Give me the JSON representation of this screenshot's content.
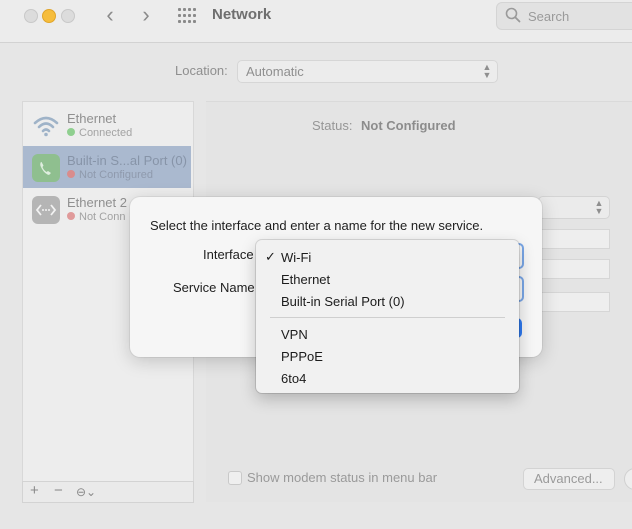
{
  "window": {
    "title": "Network"
  },
  "search": {
    "placeholder": "Search"
  },
  "location": {
    "label": "Location:",
    "value": "Automatic"
  },
  "services": [
    {
      "name": "Ethernet",
      "status": "Connected",
      "status_color": "#5cbf5c"
    },
    {
      "name": "Built-in S...al Port (0)",
      "status": "Not Configured",
      "status_color": "#e35b56"
    },
    {
      "name": "Ethernet 2",
      "status": "Not Conn",
      "status_color": "#e35b56"
    }
  ],
  "sidebar_tools": {
    "add": "+",
    "remove": "−",
    "action": "⊖⌄"
  },
  "detail": {
    "status_label": "Status:",
    "status_value": "Not Configured"
  },
  "footer": {
    "modem_label": "Show modem status in menu bar",
    "advanced": "Advanced...",
    "help": "?"
  },
  "sheet": {
    "message": "Select the interface and enter a name for the new service.",
    "interface_label": "Interface",
    "service_name_label": "Service Name"
  },
  "interface_menu": {
    "selected": "Wi-Fi",
    "items": [
      "Wi-Fi",
      "Ethernet",
      "Built-in Serial Port (0)",
      "VPN",
      "PPPoE",
      "6to4"
    ]
  },
  "colors": {
    "accent": "#2f7af0",
    "selection": "#aab9cf"
  }
}
